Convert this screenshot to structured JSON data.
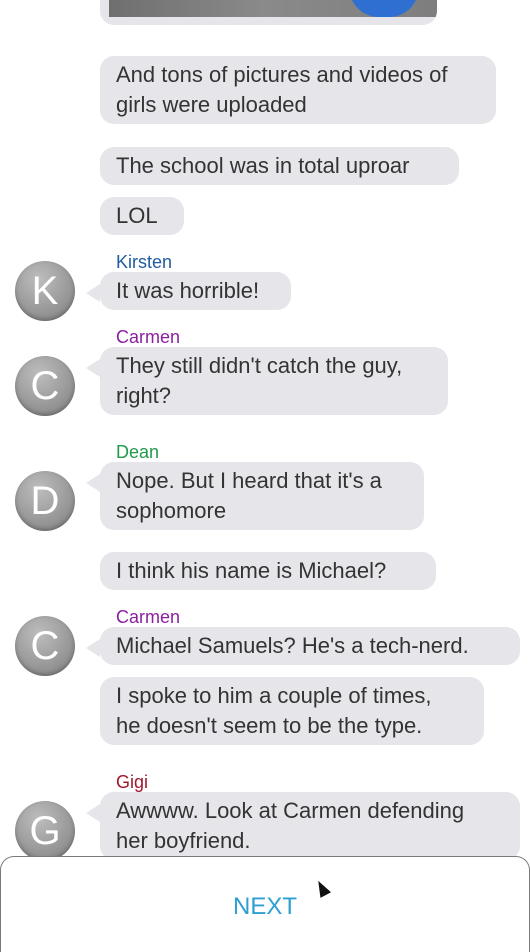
{
  "messages": [
    {
      "text_lines": [
        "And tons of pictures and videos of",
        "girls were uploaded"
      ]
    },
    {
      "text_lines": [
        "The school was in total uproar"
      ]
    },
    {
      "text_lines": [
        "LOL"
      ]
    },
    {
      "sender": "Kirsten",
      "sender_color": "#1f5b9e",
      "avatar_letter": "K",
      "text_lines": [
        "It was horrible!"
      ]
    },
    {
      "sender": "Carmen",
      "sender_color": "#8a1fa0",
      "avatar_letter": "C",
      "text_lines": [
        "They still didn't catch the guy,",
        "right?"
      ]
    },
    {
      "sender": "Dean",
      "sender_color": "#1f9a4a",
      "avatar_letter": "D",
      "text_lines": [
        "Nope. But I heard that it's a",
        "sophomore"
      ]
    },
    {
      "text_lines": [
        "I think his name is Michael?"
      ]
    },
    {
      "sender": "Carmen",
      "sender_color": "#8a1fa0",
      "avatar_letter": "C",
      "text_lines": [
        "Michael Samuels? He's a tech-nerd."
      ]
    },
    {
      "text_lines": [
        "I spoke to him a couple of times,",
        "he doesn't seem to be the type."
      ]
    },
    {
      "sender": "Gigi",
      "sender_color": "#a0182c",
      "avatar_letter": "G",
      "text_lines": [
        "Awwww. Look at Carmen defending",
        "her boyfriend."
      ]
    }
  ],
  "footer": {
    "next_label": "NEXT"
  }
}
